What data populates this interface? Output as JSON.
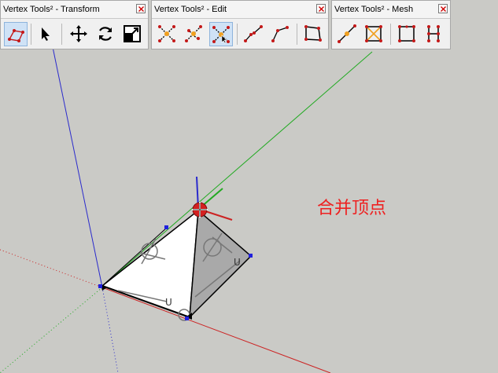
{
  "toolbars": {
    "transform": {
      "title": "Vertex Tools² - Transform",
      "close_glyph": "x"
    },
    "edit": {
      "title": "Vertex Tools² - Edit",
      "close_glyph": "x"
    },
    "mesh": {
      "title": "Vertex Tools² - Mesh",
      "close_glyph": "x"
    }
  },
  "icons": {
    "transform": [
      "vertex-select-tool-icon",
      "select-arrow-icon",
      "move-icon",
      "rotate-icon",
      "scale-icon"
    ],
    "edit": [
      "merge-vertices-icon",
      "merge-to-midpoint-icon",
      "merge-to-target-icon",
      "connect-edges-icon",
      "insert-vertex-icon",
      "triangulate-icon"
    ],
    "mesh": [
      "subdivide-edge-icon",
      "triangulate-quad-icon",
      "divide-face-icon",
      "grid-divide-icon"
    ]
  },
  "active_tool": "merge-to-target-icon",
  "viewport": {
    "annotation": "合并顶点",
    "axis_label_u": "U"
  },
  "colors": {
    "background": "#cacac6",
    "annotation": "#ee2020",
    "axis_blue": "#2a2acc",
    "axis_green": "#22aa22",
    "axis_red": "#cc2222",
    "vertex_red": "#d42020",
    "vertex_blue": "#2020dd",
    "tool_active_bg": "#cfe2f6"
  }
}
